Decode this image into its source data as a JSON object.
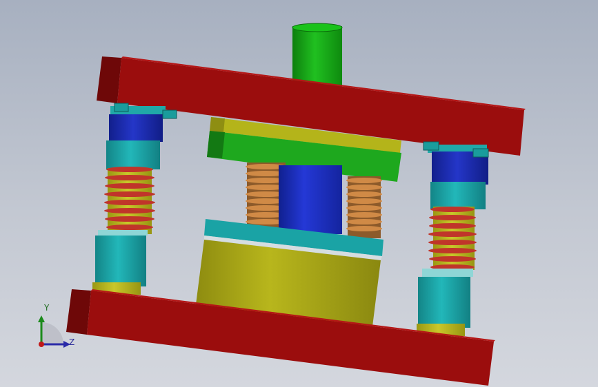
{
  "viewport": {
    "background_top": "#a7b0c0",
    "background_bottom": "#d4d7de"
  },
  "model": {
    "parts": [
      "top-plate-icon",
      "bottom-plate-icon",
      "shank-icon",
      "punch-holder-icon",
      "punch-icon",
      "die-icon",
      "guide-post-left-icon",
      "guide-post-right-icon",
      "spring-icon"
    ],
    "colors": {
      "plate": "#9b0d0d",
      "plate_dark": "#6e0808",
      "shank": "#13a313",
      "holder_yellow": "#b4b41a",
      "holder_green": "#1ea81e",
      "punch": "#1c2fc0",
      "die": "#a5a315",
      "cyan": "#1aa3a5",
      "spring_red": "#c0352a",
      "spring_copper": "#c07a3a",
      "bushing_blue": "#1b2bb8"
    }
  },
  "triad": {
    "y_label": "Y",
    "z_label": "Z"
  }
}
